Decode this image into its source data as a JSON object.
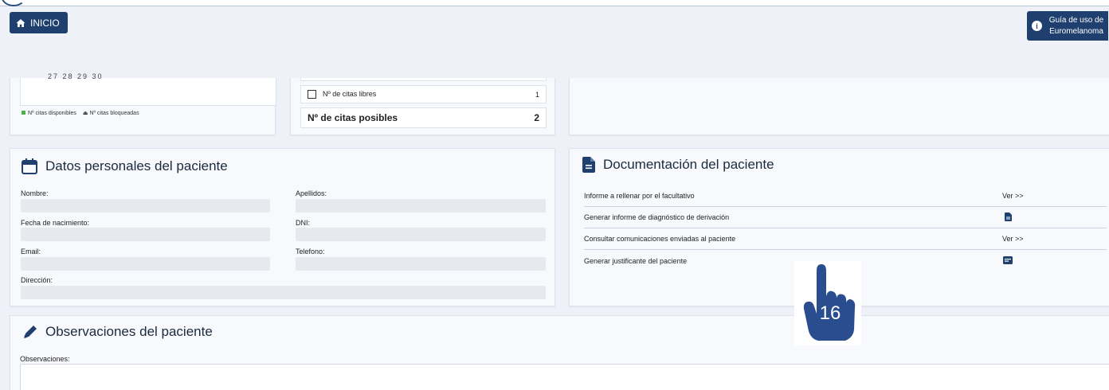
{
  "header": {
    "home_button": "INICIO",
    "guide_button_line1": "Guía de uso de",
    "guide_button_line2": "Euromelanoma"
  },
  "calendar_card": {
    "day_numbers": "27          28          29          30",
    "legend_available": "Nº citas disponibles",
    "legend_blocked": "Nº citas bloqueadas"
  },
  "citas_card": {
    "free_label": "Nº de citas libres",
    "free_value": "1",
    "possible_label": "Nº de citas posibles",
    "possible_value": "2"
  },
  "datos_personales": {
    "title": "Datos personales del paciente",
    "fields": {
      "nombre": "Nombre:",
      "apellidos": "Apellidos:",
      "fecha": "Fecha de nacimiento:",
      "dni": "DNI:",
      "email": "Email:",
      "telefono": "Telefono:",
      "direccion": "Dirección:"
    }
  },
  "documentacion": {
    "title": "Documentación del paciente",
    "rows": [
      {
        "label": "Informe a rellenar por el facultativo",
        "action": "Ver >>"
      },
      {
        "label": "Generar informe de diagnóstico de derivación",
        "action_icon": "file-icon"
      },
      {
        "label": "Consultar comunicaciones enviadas al paciente",
        "action": "Ver >>"
      },
      {
        "label": "Generar justificante del paciente",
        "action_icon": "card-icon"
      }
    ]
  },
  "observaciones": {
    "title": "Observaciones del paciente",
    "label": "Observaciones:",
    "value": ""
  },
  "overlay": {
    "step_number": "16",
    "icon": "pointing-hand-icon"
  },
  "colors": {
    "primary": "#1f3f6e",
    "background": "#eef2f8",
    "field": "#e6e9ee",
    "hand": "#2a4d8f"
  }
}
